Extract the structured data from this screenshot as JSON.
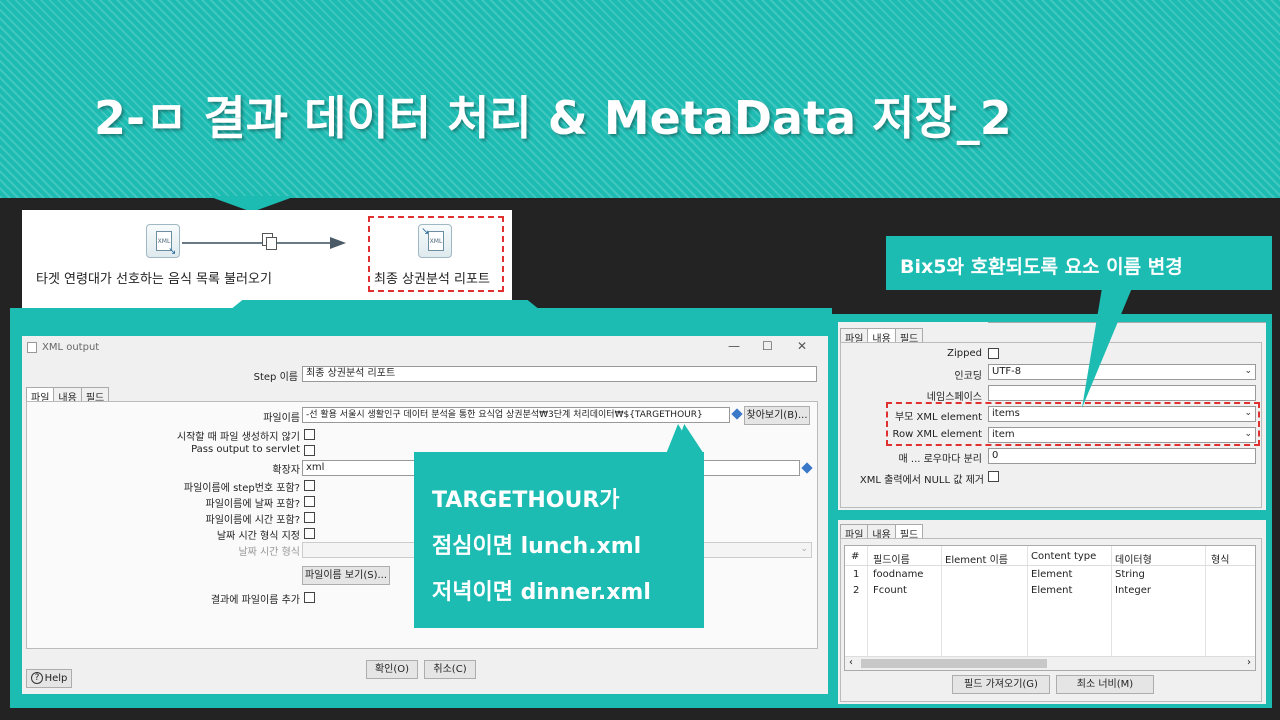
{
  "slide": {
    "title": "2-ㅁ 결과 데이터 처리 & MetaData 저장_2",
    "colors": {
      "teal": "#1cbcb3",
      "background": "#232323",
      "dash": "#e03030"
    }
  },
  "flow": {
    "step1_label": "타겟 연령대가 선호하는 음식 목록 불러오기",
    "step2_label": "최종 상권분석 리포트",
    "step_icon_text": "XML"
  },
  "dialog": {
    "title": "XML output",
    "controls": {
      "minimize": "—",
      "maximize": "☐",
      "close": "✕"
    },
    "step_name_label": "Step 이름",
    "step_name_value": "최종 상권분석 리포트",
    "tabs": [
      "파일",
      "내용",
      "필드"
    ],
    "filename_label": "파일이름",
    "filename_value": "-선 활용 서울시 생활인구 데이터 분석을 통한 요식업 상권분석₩3단계 처리데이터₩${TARGETHOUR}",
    "browse_button": "찾아보기(B)...",
    "no_create_label": "시작할 때 파일 생성하지 않기",
    "pass_servlet_label": "Pass output to servlet",
    "extension_label": "확장자",
    "extension_value": "xml",
    "include_step_label": "파일이름에 step번호 포함?",
    "include_date_label": "파일이름에 날짜 포함?",
    "include_time_label": "파일이름에 시간 포함?",
    "date_format_specify_label": "날짜 시간 형식 지정",
    "date_format_label": "날짜 시간 형식",
    "show_filenames_button": "파일이름 보기(S)...",
    "add_to_result_label": "결과에 파일이름 추가",
    "ok_button": "확인(O)",
    "cancel_button": "취소(C)",
    "help_button": "Help"
  },
  "callout_target": {
    "line1": "TARGETHOUR가",
    "line2": "점심이면 lunch.xml",
    "line3": "저녁이면 dinner.xml"
  },
  "callout_bix": {
    "text": "Bix5와 호환되도록 요소 이름 변경"
  },
  "content_panel": {
    "tabs": [
      "파일",
      "내용",
      "필드"
    ],
    "zipped_label": "Zipped",
    "encoding_label": "인코딩",
    "encoding_value": "UTF-8",
    "namespace_label": "네임스페이스",
    "namespace_value": "",
    "parent_label": "부모 XML element",
    "parent_value": "items",
    "row_label": "Row XML element",
    "row_value": "item",
    "split_label": "매 ... 로우마다 분리",
    "split_value": "0",
    "null_label": "XML 출력에서 NULL 값 제거"
  },
  "fields_panel": {
    "tabs": [
      "파일",
      "내용",
      "필드"
    ],
    "columns": [
      "#",
      "필드이름",
      "Element 이름",
      "Content type",
      "데이터형",
      "형식"
    ],
    "rows": [
      [
        "1",
        "foodname",
        "",
        "Element",
        "String",
        ""
      ],
      [
        "2",
        "Fcount",
        "",
        "Element",
        "Integer",
        ""
      ]
    ],
    "get_fields_button": "필드 가져오기(G)",
    "min_width_button": "최소 너비(M)"
  }
}
